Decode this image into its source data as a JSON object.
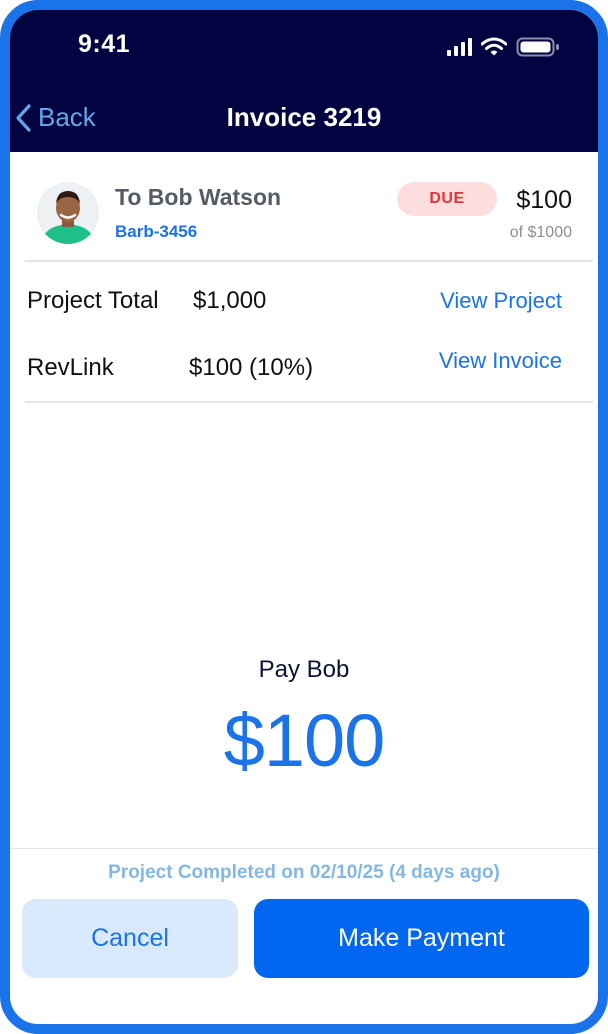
{
  "status_bar": {
    "time": "9:41",
    "icons": [
      "signal-icon",
      "wifi-icon",
      "battery-icon"
    ]
  },
  "nav": {
    "back_label": "Back",
    "title": "Invoice 3219"
  },
  "recipient": {
    "name": "To Bob Watson",
    "id": "Barb-3456",
    "status_badge": "DUE",
    "amount": "$100",
    "amount_total": "of $1000"
  },
  "details": {
    "project_total_label": "Project Total",
    "project_total_value": "$1,000",
    "view_project_link": "View Project",
    "revlink_label": "RevLink",
    "revlink_value": "$100 (10%)",
    "view_invoice_link": "View Invoice"
  },
  "payment": {
    "pay_label": "Pay Bob",
    "amount": "$100"
  },
  "footer": {
    "completed_text": "Project Completed on 02/10/25 (4 days ago)",
    "cancel_label": "Cancel",
    "make_payment_label": "Make Payment"
  },
  "colors": {
    "header_bg": "#010440",
    "accent": "#1a73e8",
    "primary_button": "#0166f0",
    "secondary_button": "#d7e9fb",
    "due_badge_bg": "#fcdede",
    "due_badge_text": "#e4363c"
  }
}
